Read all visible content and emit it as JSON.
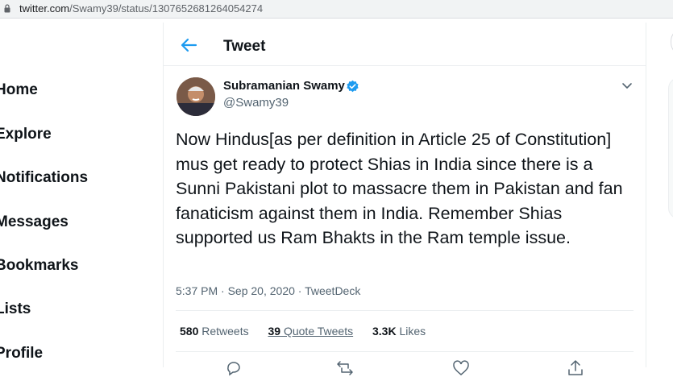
{
  "browser": {
    "url_domain": "twitter.com",
    "url_path": "/Swamy39/status/1307652681264054274"
  },
  "nav": {
    "items": [
      {
        "label": "Home"
      },
      {
        "label": "Explore"
      },
      {
        "label": "Notifications"
      },
      {
        "label": "Messages"
      },
      {
        "label": "Bookmarks"
      },
      {
        "label": "Lists"
      },
      {
        "label": "Profile"
      }
    ]
  },
  "header": {
    "title": "Tweet"
  },
  "tweet": {
    "author_name": "Subramanian Swamy",
    "handle": "@Swamy39",
    "text": "Now Hindus[as per definition in Article 25 of Constitution] mus get ready to protect Shias in India since there is a Sunni Pakistani plot to massacre them in Pakistan and fan fanaticism against them in India. Remember Shias supported us Ram Bhakts in the Ram temple issue.",
    "time": "5:37 PM",
    "date": "Sep 20, 2020",
    "source": "TweetDeck",
    "retweets_count": "580",
    "retweets_label": "Retweets",
    "quote_count": "39",
    "quote_label": "Quote Tweets",
    "likes_count": "3.3K",
    "likes_label": "Likes"
  },
  "colors": {
    "accent": "#1d9bf0",
    "text": "#0f1419",
    "secondary": "#536471"
  },
  "icons": [
    "lock-icon",
    "back-arrow-icon",
    "verified-badge-icon",
    "chevron-down-icon",
    "reply-icon",
    "retweet-icon",
    "like-icon",
    "share-icon"
  ]
}
